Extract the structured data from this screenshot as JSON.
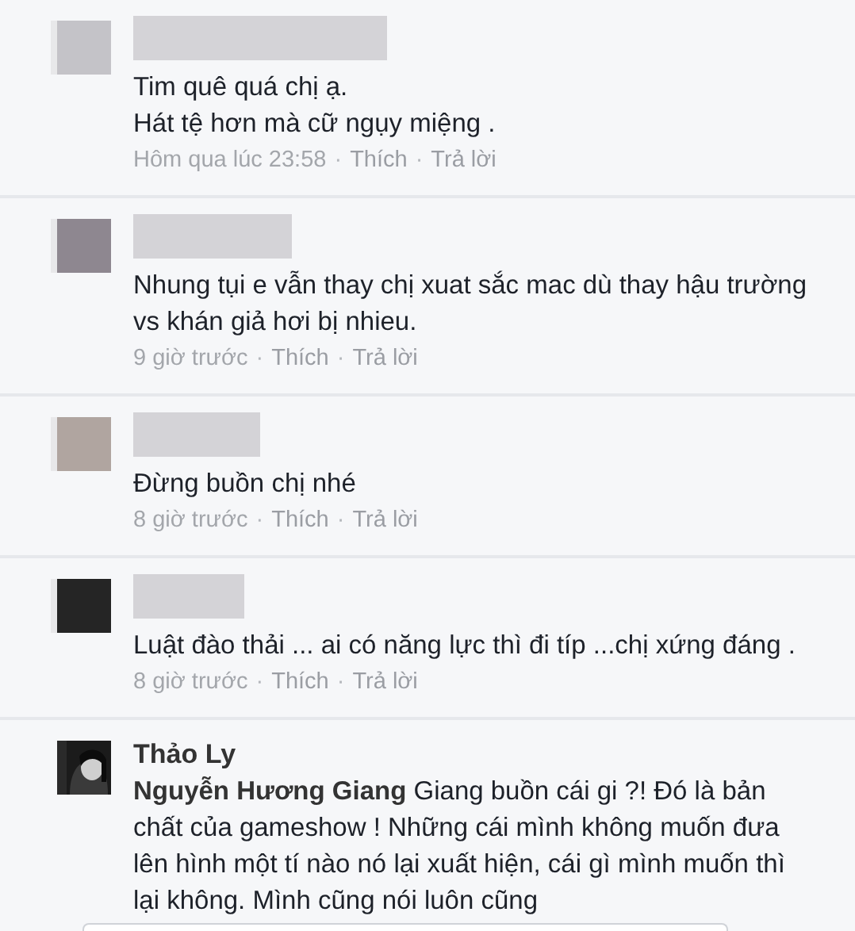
{
  "comments": [
    {
      "avatar": {
        "kind": "blurred",
        "color": "#c4c3c8"
      },
      "author": {
        "kind": "blurred"
      },
      "text": "Tim quê quá chị ạ.\nHát tệ hơn mà cữ ngụy miệng .",
      "meta": [
        {
          "kind": "time",
          "text": "Hôm qua lúc 23:58"
        },
        {
          "kind": "sep",
          "text": "·"
        },
        {
          "kind": "link",
          "text": "Thích"
        },
        {
          "kind": "sep",
          "text": "·"
        },
        {
          "kind": "link",
          "text": "Trả lời"
        }
      ]
    },
    {
      "avatar": {
        "kind": "blurred",
        "color": "#8e8790"
      },
      "author": {
        "kind": "blurred"
      },
      "text": "Nhung tụi e vẫn thay chị xuat sắc mac dù thay hậu trường vs khán giả hơi bị nhieu.",
      "meta": [
        {
          "kind": "time",
          "text": "9 giờ trước"
        },
        {
          "kind": "sep",
          "text": "·"
        },
        {
          "kind": "link",
          "text": "Thích"
        },
        {
          "kind": "sep",
          "text": "·"
        },
        {
          "kind": "link",
          "text": "Trả lời"
        }
      ]
    },
    {
      "avatar": {
        "kind": "blurred",
        "color": "#b0a5a0"
      },
      "author": {
        "kind": "blurred"
      },
      "text": "Đừng buồn chị nhé",
      "meta": [
        {
          "kind": "time",
          "text": "8 giờ trước"
        },
        {
          "kind": "sep",
          "text": "·"
        },
        {
          "kind": "link",
          "text": "Thích"
        },
        {
          "kind": "sep",
          "text": "·"
        },
        {
          "kind": "link",
          "text": "Trả lời"
        }
      ]
    },
    {
      "avatar": {
        "kind": "blurred",
        "color": "#252525"
      },
      "author": {
        "kind": "blurred"
      },
      "text": "Luật đào thải ... ai có năng lực thì đi típ ...chị xứng đáng .",
      "meta": [
        {
          "kind": "time",
          "text": "8 giờ trước"
        },
        {
          "kind": "sep",
          "text": "·"
        },
        {
          "kind": "link",
          "text": "Thích"
        },
        {
          "kind": "sep",
          "text": "·"
        },
        {
          "kind": "link",
          "text": "Trả lời"
        }
      ]
    },
    {
      "author": {
        "kind": "text",
        "text": "Thảo Ly"
      },
      "text": "**Nguyễn Hương Giang** Giang buồn cái gi ?! Đó là bản chất của gameshow ! Những cái mình không muốn đưa lên hình một tí nào nó lại xuất hiện, cái gì mình muốn thì lại không. Mình cũng nói luôn cũng"
    }
  ],
  "composer": {
    "kind": "field"
  }
}
